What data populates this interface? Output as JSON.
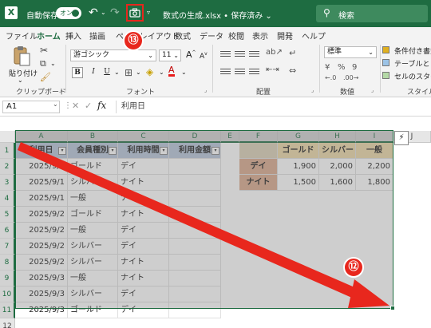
{
  "titlebar": {
    "autosave_label": "自動保存",
    "autosave_state": "オン",
    "doc_title": "数式の生成.xlsx • 保存済み ⌄",
    "search_placeholder": "検索",
    "bg_color": "#1e6c41"
  },
  "menu": {
    "tabs": [
      "ファイル",
      "ホーム",
      "挿入",
      "描画",
      "ページレイアウト",
      "数式",
      "データ",
      "校閲",
      "表示",
      "開発",
      "ヘルプ"
    ],
    "active": "ホーム"
  },
  "ribbon": {
    "clipboard": {
      "paste_label": "貼り付け",
      "group_label": "クリップボード"
    },
    "font": {
      "font_name": "游ゴシック",
      "font_size": "11",
      "grow": "A",
      "shrink": "A",
      "bold": "B",
      "italic": "I",
      "underline": "U",
      "group_label": "フォント"
    },
    "alignment": {
      "group_label": "配置"
    },
    "number": {
      "format": "標準",
      "percent": "%",
      "comma": "9",
      "group_label": "数値"
    },
    "styles": {
      "items": [
        "条件付き書式",
        "テーブルとして書",
        "セルのスタイル"
      ],
      "group_label": "スタイル"
    }
  },
  "formula_bar": {
    "name_box": "A1",
    "fx": "fx",
    "content": "利用日"
  },
  "grid": {
    "columns": [
      "A",
      "B",
      "C",
      "D",
      "E",
      "F",
      "G",
      "H",
      "I",
      "J"
    ],
    "rows": [
      "1",
      "2",
      "3",
      "4",
      "5",
      "6",
      "7",
      "8",
      "9",
      "10",
      "11",
      "12"
    ],
    "headers": [
      "利用日",
      "会員種別",
      "利用時間",
      "利用金額"
    ],
    "records": [
      [
        "2025/9/1",
        "ゴールド",
        "デイ"
      ],
      [
        "2025/9/1",
        "シルバー",
        "ナイト"
      ],
      [
        "2025/9/1",
        "一般",
        "ナイト"
      ],
      [
        "2025/9/2",
        "ゴールド",
        "ナイト"
      ],
      [
        "2025/9/2",
        "一般",
        "デイ"
      ],
      [
        "2025/9/2",
        "シルバー",
        "デイ"
      ],
      [
        "2025/9/2",
        "シルバー",
        "ナイト"
      ],
      [
        "2025/9/3",
        "一般",
        "ナイト"
      ],
      [
        "2025/9/3",
        "シルバー",
        "デイ"
      ],
      [
        "2025/9/3",
        "ゴールド",
        "デイ"
      ]
    ],
    "fee_table": {
      "col_headers": [
        "ゴールド",
        "シルバー",
        "一般"
      ],
      "rows": [
        {
          "label": "デイ",
          "values": [
            "1,900",
            "2,000",
            "2,200"
          ]
        },
        {
          "label": "ナイト",
          "values": [
            "1,500",
            "1,600",
            "1,800"
          ]
        }
      ]
    }
  },
  "annotations": {
    "badge_camera": "⑬",
    "badge_arrow": "⑫",
    "color": "#e8271d"
  }
}
